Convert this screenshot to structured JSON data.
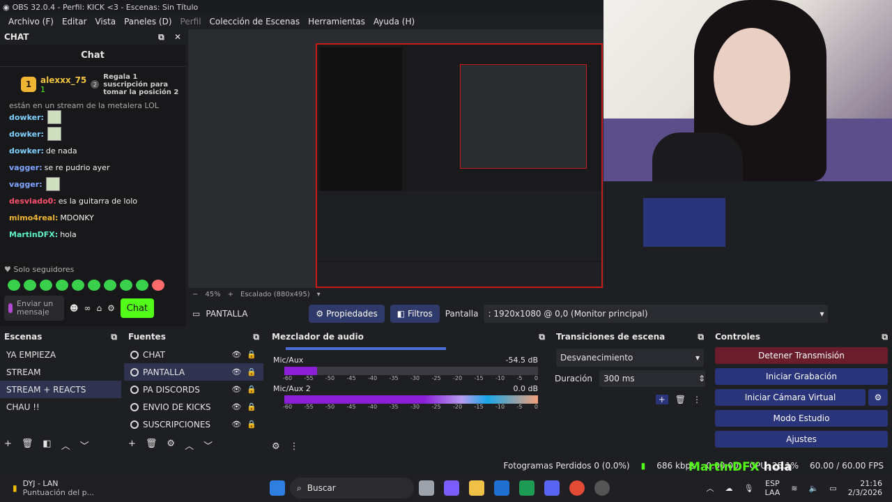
{
  "window": {
    "title": "OBS 32.0.4 - Perfil: KICK <3 - Escenas: Sin Título"
  },
  "menu": [
    "Archivo (F)",
    "Editar",
    "Vista",
    "Paneles (D)",
    "Perfil",
    "Colección de Escenas",
    "Herramientas",
    "Ayuda (H)"
  ],
  "chat": {
    "dock_title": "CHAT",
    "title": "Chat",
    "leader": {
      "rank": "1",
      "name": "alexxx_75",
      "count": "1",
      "gift_rank": "2",
      "gift_text": [
        "Regala 1",
        "suscripción para",
        "tomar la posición 2"
      ]
    },
    "partial_top": "están en un stream de la metalera LOL",
    "messages": [
      {
        "user": "dowker:",
        "text": "",
        "color": "#7fd0ff",
        "emote": true
      },
      {
        "user": "dowker:",
        "text": "",
        "color": "#7fd0ff",
        "emote": true
      },
      {
        "user": "dowker:",
        "text": "de nada",
        "color": "#7fd0ff",
        "emote": false
      },
      {
        "user": "vagger:",
        "text": "se re pudrio ayer",
        "color": "#7fa6ff",
        "emote": false
      },
      {
        "user": "vagger:",
        "text": "",
        "color": "#7fa6ff",
        "emote": true
      },
      {
        "user": "desviado0:",
        "text": "es la guitarra de lolo",
        "color": "#ff4f6a",
        "emote": false
      },
      {
        "user": "mimo4real:",
        "text": "MDONKY",
        "color": "#f0b532",
        "emote": false
      },
      {
        "user": "MartinDFX:",
        "text": "hola",
        "color": "#5cf0c6",
        "emote": false
      }
    ],
    "followers_only": "Solo seguidores",
    "input_placeholder": "Enviar un mensaje",
    "send_label": "Chat"
  },
  "preview": {
    "zoom": "45%",
    "scaling": "Escalado (880x495)"
  },
  "properties": {
    "source_name": "PANTALLA",
    "props_label": "Propiedades",
    "filters_label": "Filtros",
    "display_label": "Pantalla",
    "display_value": ": 1920x1080 @ 0,0 (Monitor principal)"
  },
  "scenes": {
    "title": "Escenas",
    "items": [
      "YA EMPIEZA",
      "STREAM",
      "STREAM + REACTS",
      "CHAU !!"
    ],
    "selected": 2
  },
  "sources": {
    "title": "Fuentes",
    "items": [
      "CHAT",
      "PANTALLA",
      "PA DISCORDS",
      "ENVIO DE KICKS",
      "SUSCRIPCIONES"
    ],
    "selected": 1
  },
  "mixer": {
    "title": "Mezclador de audio",
    "channels": [
      {
        "name": "Mic/Aux",
        "db": "-54.5 dB",
        "volume": 0.13
      },
      {
        "name": "Mic/Aux 2",
        "db": "0.0 dB",
        "volume": 1.0
      }
    ],
    "ticks": [
      "-60",
      "-55",
      "-50",
      "-45",
      "-40",
      "-35",
      "-30",
      "-25",
      "-20",
      "-15",
      "-10",
      "-5",
      "0"
    ]
  },
  "transitions": {
    "title": "Transiciones de escena",
    "type": "Desvanecimiento",
    "duration_label": "Duración",
    "duration_value": "300 ms"
  },
  "controls": {
    "title": "Controles",
    "buttons": [
      "Detener Transmisión",
      "Iniciar Grabación",
      "Iniciar Cámara Virtual",
      "Modo Estudio",
      "Ajustes"
    ]
  },
  "status": {
    "dropped": "Fotogramas Perdidos 0 (0.0%)",
    "kbps": "686 kbps",
    "time": "0:00:00",
    "cpu": "CPU: 25.1%",
    "fps": "60.00 / 60.00 FPS"
  },
  "overlay": {
    "name": "MartinDFX",
    "text": "hola"
  },
  "taskbar": {
    "app_title": "DYJ - LAN",
    "app_subtitle": "Puntuación del p...",
    "search": "Buscar",
    "lang": "ESP",
    "lang2": "LAA",
    "clock": "21:16",
    "date": "2/3/2026"
  },
  "colors": {
    "kick_green": "#53fc18",
    "accent_blue": "#29347a",
    "stop_red": "#6a1e2c"
  }
}
